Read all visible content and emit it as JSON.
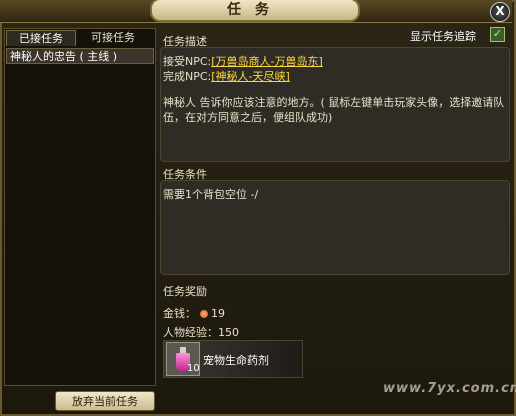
{
  "window": {
    "title": "任务",
    "close_label": "X"
  },
  "tabs": [
    {
      "label": "已接任务",
      "active": true
    },
    {
      "label": "可接任务",
      "active": false
    }
  ],
  "quest_list": [
    {
      "label": "神秘人的忠告 ( 主线 )"
    }
  ],
  "abandon_button": "放弃当前任务",
  "track": {
    "label": "显示任务追踪",
    "checked": true
  },
  "description": {
    "section_title": "任务描述",
    "accept_prefix": "接受NPC:",
    "accept_npc": "[万兽岛商人-万兽岛东]",
    "complete_prefix": "完成NPC:",
    "complete_npc": "[神秘人-天尽峡]",
    "text": "神秘人 告诉你应该注意的地方。( 鼠标左键单击玩家头像，选择邀请队伍，在对方同意之后，便组队成功)"
  },
  "conditions": {
    "section_title": "任务条件",
    "text": "需要1个背包空位    -/"
  },
  "rewards": {
    "section_title": "任务奖励",
    "money_label": "金钱：",
    "money_value": "19",
    "exp_label": "人物经验：",
    "exp_value": "150",
    "item": {
      "name": "宠物生命药剂",
      "count": "10",
      "icon": "pink-potion-icon"
    }
  },
  "watermark": "www.7yx.com.cn",
  "colors": {
    "link": "#ffd840",
    "accent_border": "#6b5a2e",
    "panel": "#2e2c24"
  }
}
